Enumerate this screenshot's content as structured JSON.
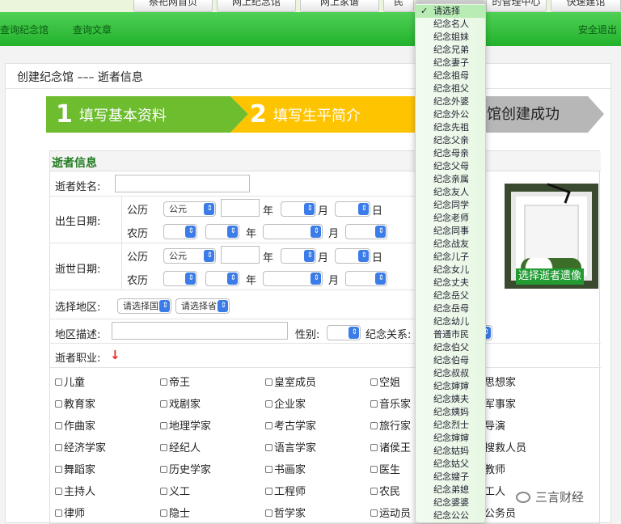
{
  "top_nav": {
    "tabs": [
      "祭祀网首页",
      "网上纪念馆",
      "网上家谱",
      "民",
      "的管理中心",
      "快速建馆"
    ]
  },
  "green_bar": {
    "left_links": [
      "查询纪念馆",
      "查询文章"
    ],
    "logout": "安全退出"
  },
  "page": {
    "title": "创建纪念馆 ––– 逝者信息"
  },
  "steps": [
    {
      "num": "1",
      "label": "填写基本资料"
    },
    {
      "num": "2",
      "label": "填写生平简介"
    },
    {
      "num": "",
      "label": "馆创建成功"
    }
  ],
  "form": {
    "section_title": "逝者信息",
    "name_label": "逝者姓名:",
    "name_value": "",
    "birth_label": "出生日期:",
    "death_label": "逝世日期:",
    "gregorian": "公历",
    "lunar": "农历",
    "era_value": "公元",
    "year": "年",
    "month": "月",
    "day": "日",
    "region_label": "选择地区:",
    "country_placeholder": "请选择国家",
    "province_placeholder": "请选择省市",
    "region_desc_label": "地区描述:",
    "gender_label": "性别:",
    "relation_label": "纪念关系:",
    "occupation_label": "逝者职业:",
    "occupation_arrow": "↓",
    "photo_button": "选择逝者遗像",
    "occupations": [
      [
        "儿童",
        "帝王",
        "皇室成员",
        "空姐",
        "思想家"
      ],
      [
        "教育家",
        "戏剧家",
        "企业家",
        "音乐家",
        "军事家"
      ],
      [
        "作曲家",
        "地理学家",
        "考古学家",
        "旅行家",
        "导演"
      ],
      [
        "经济学家",
        "经纪人",
        "语言学家",
        "诸侯王",
        "搜救人员"
      ],
      [
        "舞蹈家",
        "历史学家",
        "书画家",
        "医生",
        "教师"
      ],
      [
        "主持人",
        "义工",
        "工程师",
        "农民",
        "工人"
      ],
      [
        "律师",
        "隐士",
        "哲学家",
        "运动员",
        "公务员"
      ]
    ]
  },
  "relation_dropdown": {
    "selected": "请选择",
    "options": [
      "请选择",
      "纪念名人",
      "纪念姐妹",
      "纪念兄弟",
      "纪念妻子",
      "纪念祖母",
      "纪念祖父",
      "纪念外婆",
      "纪念外公",
      "纪念先祖",
      "纪念父亲",
      "纪念母亲",
      "纪念父母",
      "纪念亲属",
      "纪念友人",
      "纪念同学",
      "纪念老师",
      "纪念同事",
      "纪念战友",
      "纪念儿子",
      "纪念女儿",
      "纪念丈夫",
      "纪念岳父",
      "纪念岳母",
      "纪念幼儿",
      "普通市民",
      "纪念伯父",
      "纪念伯母",
      "纪念叔叔",
      "纪念婶婶",
      "纪念姨夫",
      "纪念姨妈",
      "纪念烈士",
      "纪念婶婶",
      "纪念姑妈",
      "纪念姑父",
      "纪念嫂子",
      "纪念弟媳",
      "纪念婆婆",
      "纪念公公"
    ]
  },
  "watermark": "三言财经"
}
